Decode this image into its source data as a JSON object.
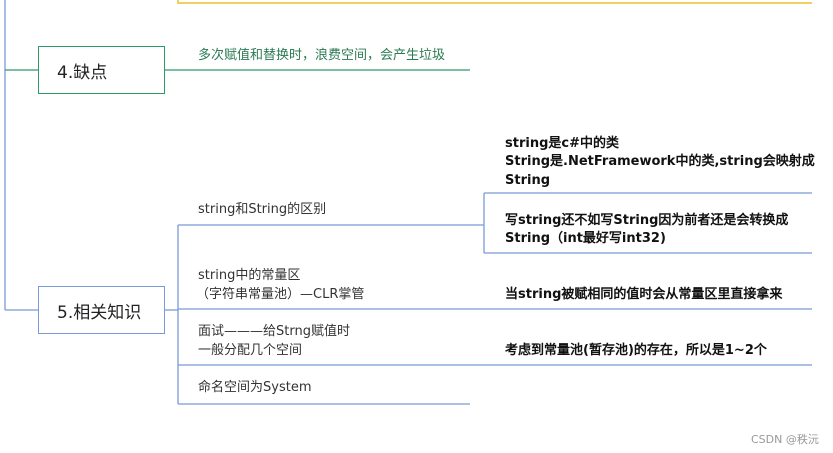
{
  "nodes": {
    "shortcomings": {
      "title": "4.缺点",
      "detail": "多次赋值和替换时，浪费空间，会产生垃圾"
    },
    "related": {
      "title": "5.相关知识",
      "items": [
        {
          "label": "string和String的区别",
          "children": [
            {
              "lines": [
                "string是c#中的类",
                "String是.NetFramework中的类,string会映射成",
                "String"
              ]
            },
            {
              "lines": [
                "写string还不如写String因为前者还是会转换成",
                "String（int最好写int32)"
              ]
            }
          ]
        },
        {
          "label_lines": [
            "string中的常量区",
            "（字符串常量池）—CLR掌管"
          ],
          "children": [
            {
              "lines": [
                "当string被赋相同的值时会从常量区里直接拿来"
              ]
            }
          ]
        },
        {
          "label_lines": [
            "面试———给Strng赋值时",
            "一般分配几个空间"
          ],
          "children": [
            {
              "lines": [
                "考虑到常量池(暂存池)的存在，所以是1~2个"
              ]
            }
          ]
        },
        {
          "label": "命名空间为System"
        }
      ]
    }
  },
  "watermark": "CSDN @秩沅"
}
